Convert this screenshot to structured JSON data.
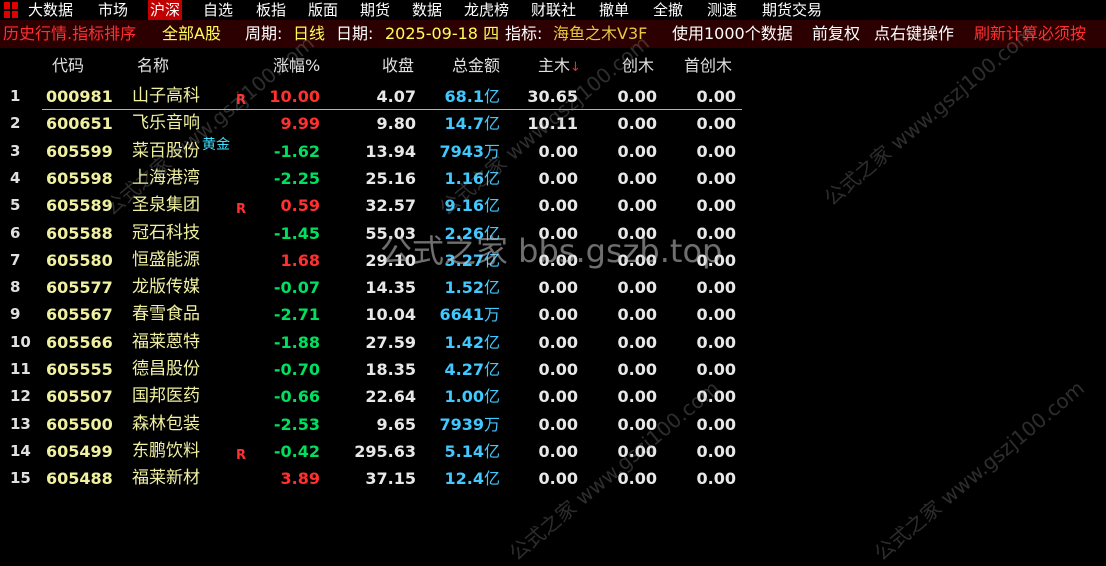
{
  "menu": [
    "大数据",
    "市场",
    "沪深",
    "自选",
    "板指",
    "版面",
    "期货",
    "数据",
    "龙虎榜",
    "财联社",
    "撤单",
    "全撤",
    "测速",
    "期货交易"
  ],
  "menu_active": "沪深",
  "infobar": {
    "mode": "历史行情.指标排序",
    "scope": "全部A股",
    "period_label": "周期:",
    "period": "日线",
    "date_label": "日期:",
    "date": "2025-09-18 四",
    "indicator_label": "指标:",
    "indicator": "海鱼之木V3F",
    "usage": "使用1000个数据",
    "adjust": "前复权",
    "right_click": "点右键操作",
    "refresh": "刷新计算必须按"
  },
  "columns": {
    "code": "代码",
    "name": "名称",
    "change_pct": "涨幅%",
    "close": "收盘",
    "amount": "总金额",
    "main": "主木",
    "sort_arrow": "↓",
    "chuang": "创木",
    "first": "首创木"
  },
  "rows": [
    {
      "idx": "1",
      "code": "000981",
      "name": "山子高科",
      "tag": "R",
      "chg": "10.00",
      "dir": "up",
      "close": "4.07",
      "amt": "68.1",
      "unit": "亿",
      "main": "30.65",
      "chuang": "0.00",
      "first": "0.00"
    },
    {
      "idx": "2",
      "code": "600651",
      "name": "飞乐音响",
      "tag": "",
      "chg": "9.99",
      "dir": "up",
      "close": "9.80",
      "amt": "14.7",
      "unit": "亿",
      "main": "10.11",
      "chuang": "0.00",
      "first": "0.00"
    },
    {
      "idx": "3",
      "code": "605599",
      "name": "菜百股份",
      "tag": "黄金",
      "chg": "-1.62",
      "dir": "down",
      "close": "13.94",
      "amt": "7943",
      "unit": "万",
      "main": "0.00",
      "chuang": "0.00",
      "first": "0.00"
    },
    {
      "idx": "4",
      "code": "605598",
      "name": "上海港湾",
      "tag": "",
      "chg": "-2.25",
      "dir": "down",
      "close": "25.16",
      "amt": "1.16",
      "unit": "亿",
      "main": "0.00",
      "chuang": "0.00",
      "first": "0.00"
    },
    {
      "idx": "5",
      "code": "605589",
      "name": "圣泉集团",
      "tag": "R",
      "chg": "0.59",
      "dir": "up",
      "close": "32.57",
      "amt": "9.16",
      "unit": "亿",
      "main": "0.00",
      "chuang": "0.00",
      "first": "0.00"
    },
    {
      "idx": "6",
      "code": "605588",
      "name": "冠石科技",
      "tag": "",
      "chg": "-1.45",
      "dir": "down",
      "close": "55.03",
      "amt": "2.26",
      "unit": "亿",
      "main": "0.00",
      "chuang": "0.00",
      "first": "0.00"
    },
    {
      "idx": "7",
      "code": "605580",
      "name": "恒盛能源",
      "tag": "",
      "chg": "1.68",
      "dir": "up",
      "close": "29.10",
      "amt": "3.27",
      "unit": "亿",
      "main": "0.00",
      "chuang": "0.00",
      "first": "0.00"
    },
    {
      "idx": "8",
      "code": "605577",
      "name": "龙版传媒",
      "tag": "",
      "chg": "-0.07",
      "dir": "down",
      "close": "14.35",
      "amt": "1.52",
      "unit": "亿",
      "main": "0.00",
      "chuang": "0.00",
      "first": "0.00"
    },
    {
      "idx": "9",
      "code": "605567",
      "name": "春雪食品",
      "tag": "",
      "chg": "-2.71",
      "dir": "down",
      "close": "10.04",
      "amt": "6641",
      "unit": "万",
      "main": "0.00",
      "chuang": "0.00",
      "first": "0.00"
    },
    {
      "idx": "10",
      "code": "605566",
      "name": "福莱蒽特",
      "tag": "",
      "chg": "-1.88",
      "dir": "down",
      "close": "27.59",
      "amt": "1.42",
      "unit": "亿",
      "main": "0.00",
      "chuang": "0.00",
      "first": "0.00"
    },
    {
      "idx": "11",
      "code": "605555",
      "name": "德昌股份",
      "tag": "",
      "chg": "-0.70",
      "dir": "down",
      "close": "18.35",
      "amt": "4.27",
      "unit": "亿",
      "main": "0.00",
      "chuang": "0.00",
      "first": "0.00"
    },
    {
      "idx": "12",
      "code": "605507",
      "name": "国邦医药",
      "tag": "",
      "chg": "-0.66",
      "dir": "down",
      "close": "22.64",
      "amt": "1.00",
      "unit": "亿",
      "main": "0.00",
      "chuang": "0.00",
      "first": "0.00"
    },
    {
      "idx": "13",
      "code": "605500",
      "name": "森林包装",
      "tag": "",
      "chg": "-2.53",
      "dir": "down",
      "close": "9.65",
      "amt": "7939",
      "unit": "万",
      "main": "0.00",
      "chuang": "0.00",
      "first": "0.00"
    },
    {
      "idx": "14",
      "code": "605499",
      "name": "东鹏饮料",
      "tag": "R",
      "chg": "-0.42",
      "dir": "down",
      "close": "295.63",
      "amt": "5.14",
      "unit": "亿",
      "main": "0.00",
      "chuang": "0.00",
      "first": "0.00"
    },
    {
      "idx": "15",
      "code": "605488",
      "name": "福莱新材",
      "tag": "",
      "chg": "3.89",
      "dir": "up",
      "close": "37.15",
      "amt": "12.4",
      "unit": "亿",
      "main": "0.00",
      "chuang": "0.00",
      "first": "0.00"
    }
  ],
  "watermark": "公式之家 bbs.gszb.top",
  "watermark_small": "公式之家 www.gszj100.com",
  "colors": {
    "up": "#ff3030",
    "down": "#00e060",
    "amount": "#40c8ff",
    "code": "#f0f0a0",
    "active_menu": "#c00000"
  }
}
